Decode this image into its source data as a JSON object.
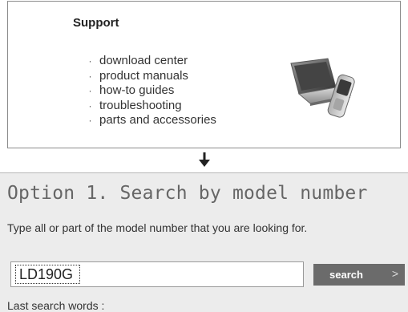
{
  "support": {
    "title": "Support",
    "links": [
      "download center",
      "product manuals",
      "how-to guides",
      "troubleshooting",
      "parts and accessories"
    ],
    "bullet": "·"
  },
  "search": {
    "title": "Option 1. Search by model number",
    "instruction": "Type all or part of the model number that you are looking for.",
    "input_value": "LD190G",
    "button_label": "search",
    "button_chevron": ">",
    "last_search_label": "Last search words :"
  },
  "colors": {
    "panel_bg": "#ececec",
    "button_bg": "#6b6b6b",
    "title_color": "#666666"
  },
  "icons": {
    "devices": "laptop-and-phone-icon",
    "flow_arrow": "down-arrow-icon",
    "button_chevron": "chevron-right-icon"
  }
}
